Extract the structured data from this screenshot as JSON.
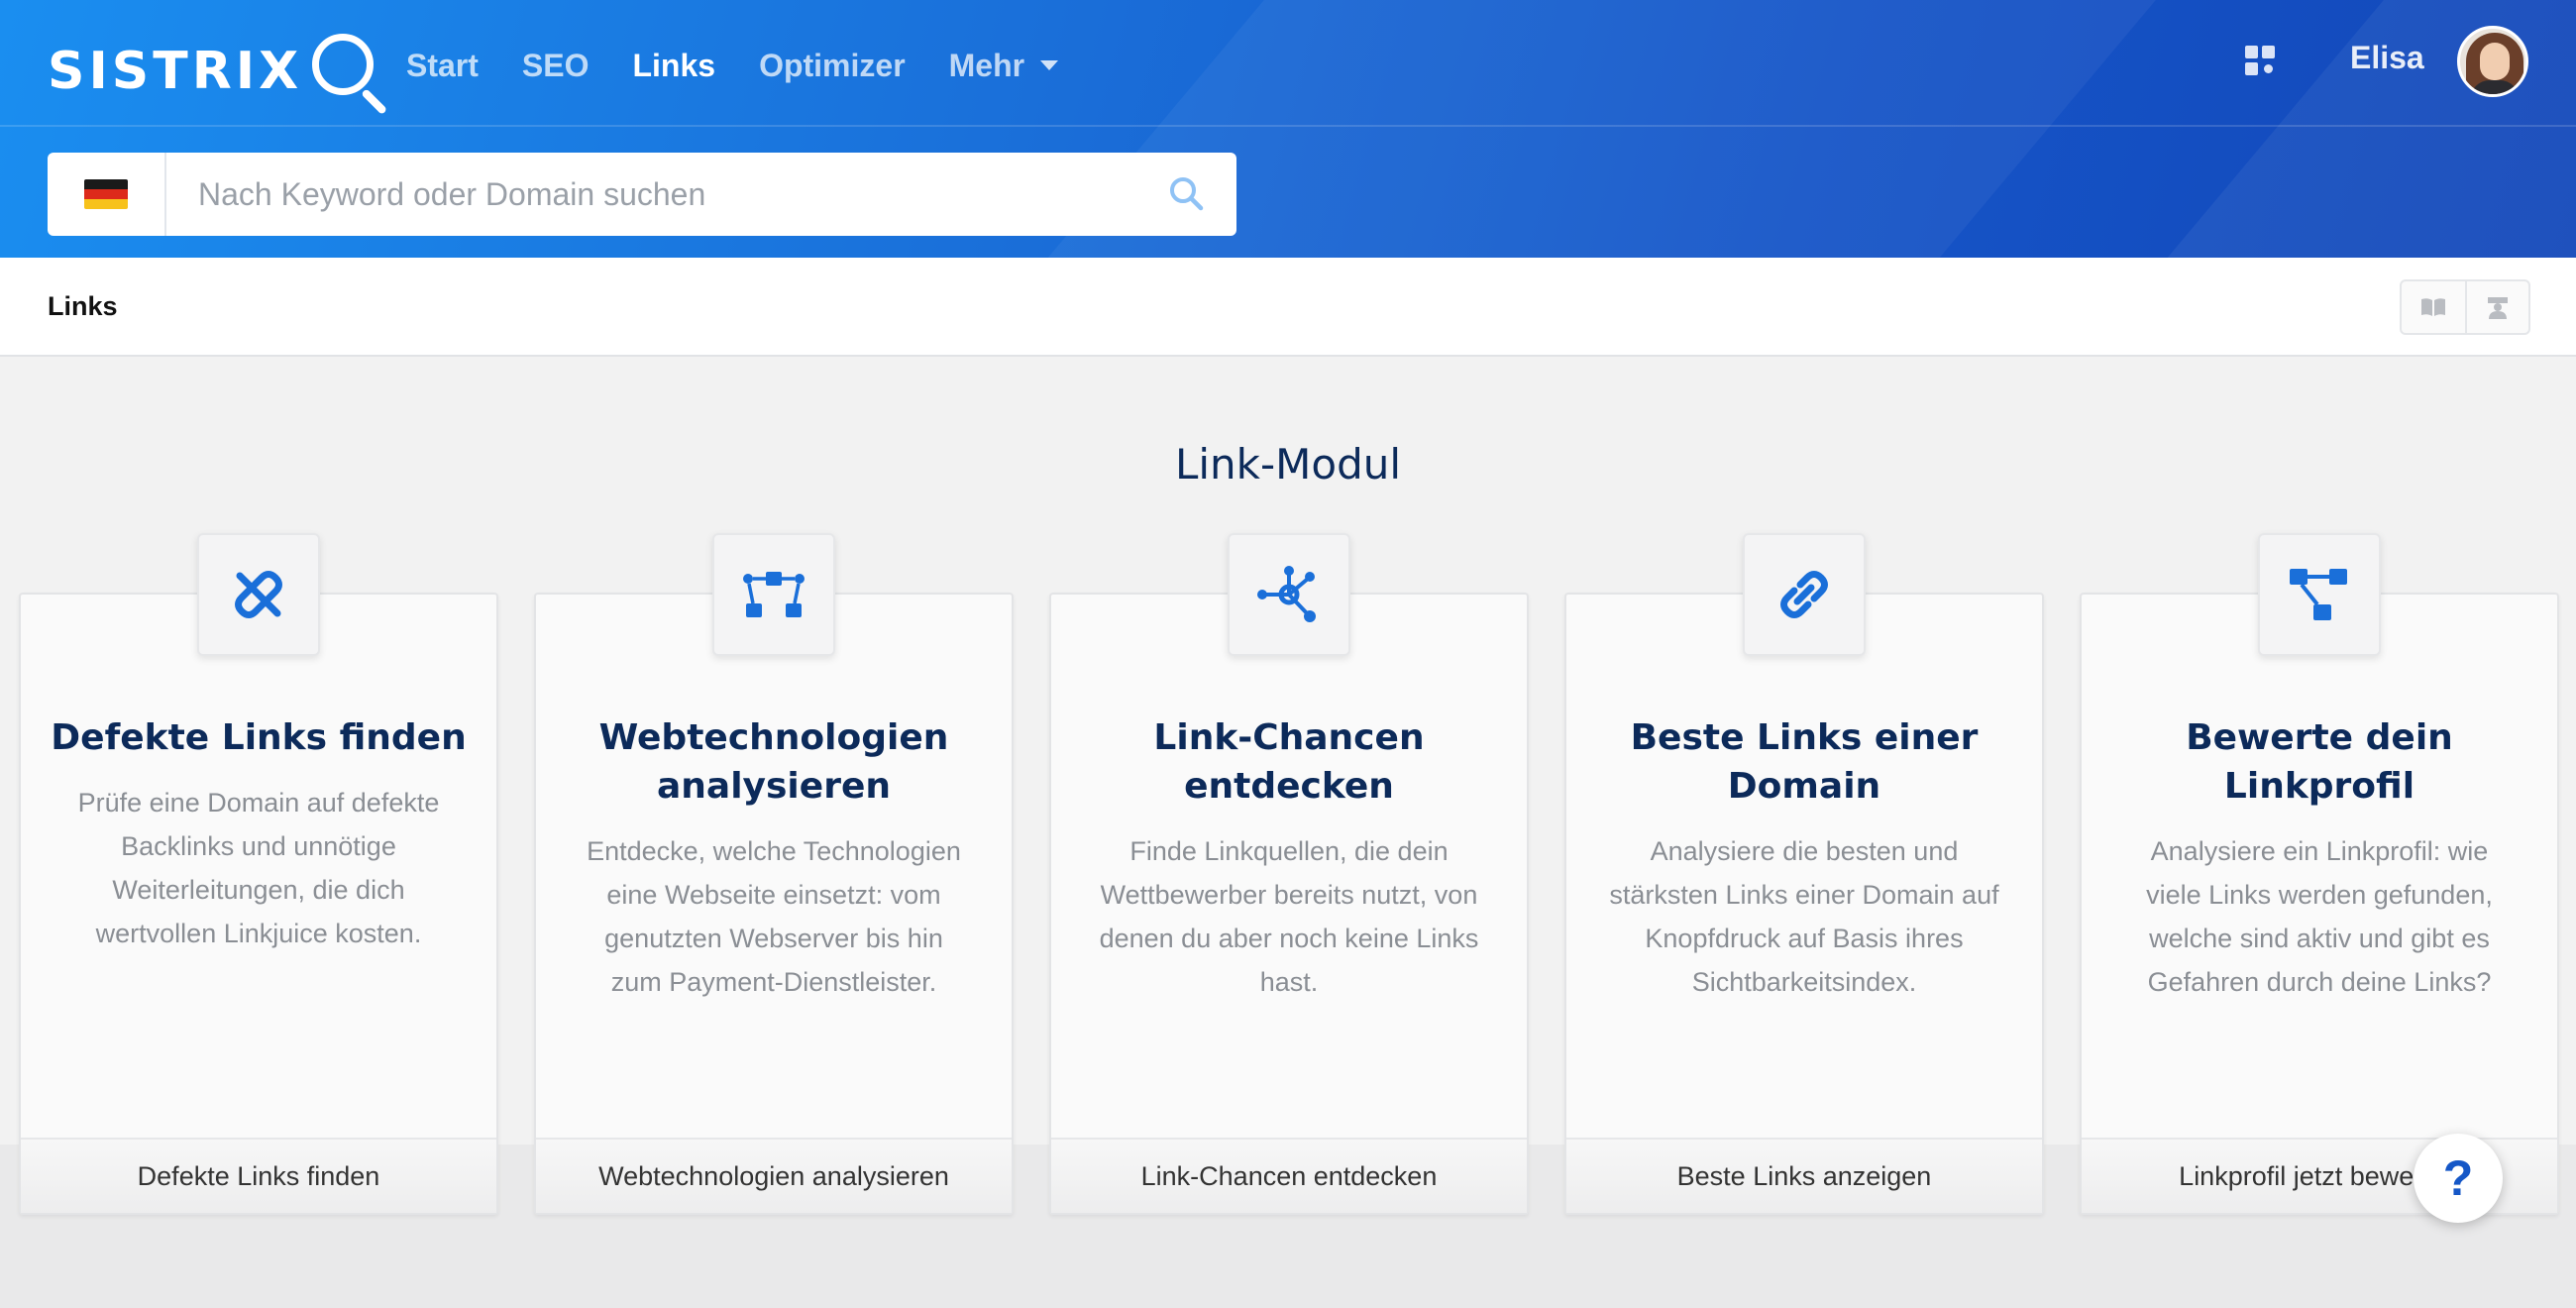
{
  "logo": {
    "text": "SISTRIX"
  },
  "nav": {
    "items": [
      {
        "label": "Start",
        "active": false
      },
      {
        "label": "SEO",
        "active": false
      },
      {
        "label": "Links",
        "active": true
      },
      {
        "label": "Optimizer",
        "active": false
      },
      {
        "label": "Mehr",
        "active": false,
        "has_dropdown": true
      }
    ]
  },
  "user": {
    "name": "Elisa",
    "icons": {
      "apps": "apps-grid-icon",
      "avatar": "user-avatar"
    }
  },
  "search": {
    "placeholder": "Nach Keyword oder Domain suchen",
    "value": "",
    "country": "DE",
    "icon": "search-icon"
  },
  "breadcrumb": {
    "label": "Links",
    "tools": [
      "book-icon",
      "graduation-icon"
    ]
  },
  "main": {
    "title": "Link-Modul",
    "cards": [
      {
        "icon": "broken-link-icon",
        "title": "Defekte Links finden",
        "description": "Prüfe eine Domain auf defekte Backlinks und unnötige Weiterleitungen, die dich wertvollen Linkjuice kosten.",
        "button": "Defekte Links finden"
      },
      {
        "icon": "tech-network-icon",
        "title": "Webtechnologien analysieren",
        "description": "Entdecke, welche Technologien eine Webseite einsetzt: vom genutzten Webserver bis hin zum Payment-Dienstleister.",
        "button": "Webtechnologien analysieren"
      },
      {
        "icon": "link-opportunity-icon",
        "title": "Link-Chancen entdecken",
        "description": "Finde Linkquellen, die dein Wettbewerber bereits nutzt, von denen du aber noch keine Links hast.",
        "button": "Link-Chancen entdecken"
      },
      {
        "icon": "chain-link-icon",
        "title": "Beste Links einer Domain",
        "description": "Analysiere die besten und stärksten Links einer Domain auf Knopfdruck auf Basis ihres Sichtbarkeitsindex.",
        "button": "Beste Links anzeigen"
      },
      {
        "icon": "link-tree-icon",
        "title": "Bewerte dein Linkprofil",
        "description": "Analysiere ein Linkprofil: wie viele Links werden gefunden, welche sind aktiv und gibt es Gefahren durch deine Links?",
        "button": "Linkprofil jetzt bewerten"
      }
    ]
  },
  "help": {
    "label": "?"
  },
  "colors": {
    "brand_blue": "#1a6fd9",
    "title_navy": "#0c2a5a",
    "icon_blue": "#1a6fd9"
  }
}
